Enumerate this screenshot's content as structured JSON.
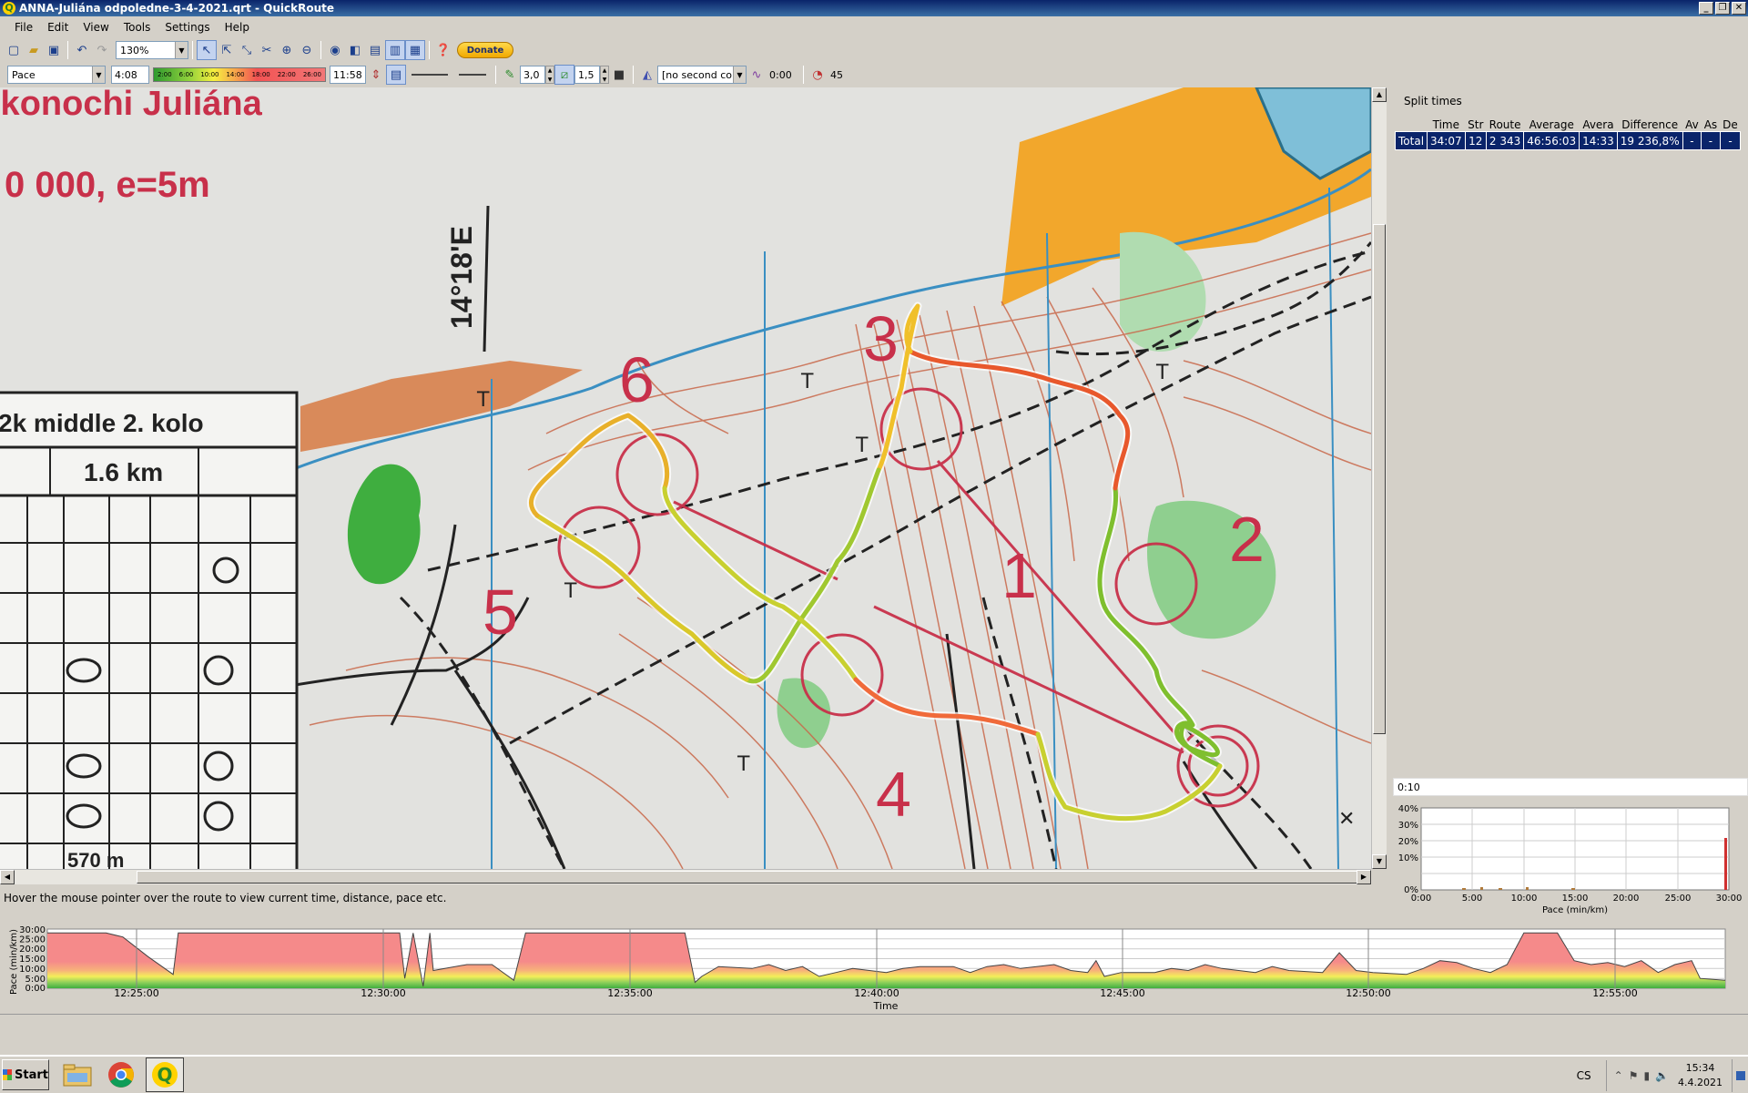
{
  "window": {
    "title": "ANNA-Juliána odpoledne-3-4-2021.qrt - QuickRoute"
  },
  "menu": [
    "File",
    "Edit",
    "View",
    "Tools",
    "Settings",
    "Help"
  ],
  "toolbar": {
    "zoom": "130%",
    "donate_label": "Donate",
    "color_mode": "Pace",
    "grad_low": "4:08",
    "grad_ticks": [
      "2:00",
      "6:00",
      "10:00",
      "14:00",
      "18:00",
      "22:00",
      "26:00"
    ],
    "grad_high": "11:58",
    "line_width": "3,0",
    "mask_width": "1,5",
    "second_color": "[no second color",
    "smoothing": "0:00",
    "circle_time_radius": "45"
  },
  "map": {
    "header_text": "ikonochi Juliána",
    "scale_text": "0 000, e=5m",
    "meridian_text": "14°18'E",
    "event_text": "2k middle 2. kolo",
    "distance_text": "1.6 km",
    "bottom_distance_text": "570 m",
    "control_numbers": [
      "1",
      "2",
      "3",
      "4",
      "5",
      "6"
    ]
  },
  "status_message": "Hover the mouse pointer over the route to view current time, distance, pace etc.",
  "split_times": {
    "title": "Split times",
    "columns": [
      "Time",
      "Str",
      "Route",
      "Average",
      "Avera",
      "Difference",
      "Av",
      "As",
      "De"
    ],
    "total_row": [
      "Total",
      "34:07",
      "12",
      "2 343",
      "46:56:03",
      "14:33",
      "19 236,8%",
      "-",
      "-",
      "-"
    ]
  },
  "histogram": {
    "time_value": "0:10",
    "y_ticks": [
      "40%",
      "30%",
      "20%",
      "10%",
      "0%"
    ],
    "x_ticks": [
      "0:00",
      "5:00",
      "10:00",
      "15:00",
      "20:00",
      "25:00",
      "30:00"
    ],
    "xlabel": "Pace (min/km)"
  },
  "pace_graph": {
    "ylabel": "Pace (min/km)",
    "y_ticks": [
      "30:00",
      "25:00",
      "20:00",
      "15:00",
      "10:00",
      "5:00",
      "0:00"
    ],
    "x_ticks": [
      "12:25:00",
      "12:30:00",
      "12:35:00",
      "12:40:00",
      "12:45:00",
      "12:50:00",
      "12:55:00"
    ],
    "xlabel": "Time"
  },
  "taskbar": {
    "start_label": "Start",
    "language": "CS",
    "time": "15:34",
    "date": "4.4.2021"
  }
}
